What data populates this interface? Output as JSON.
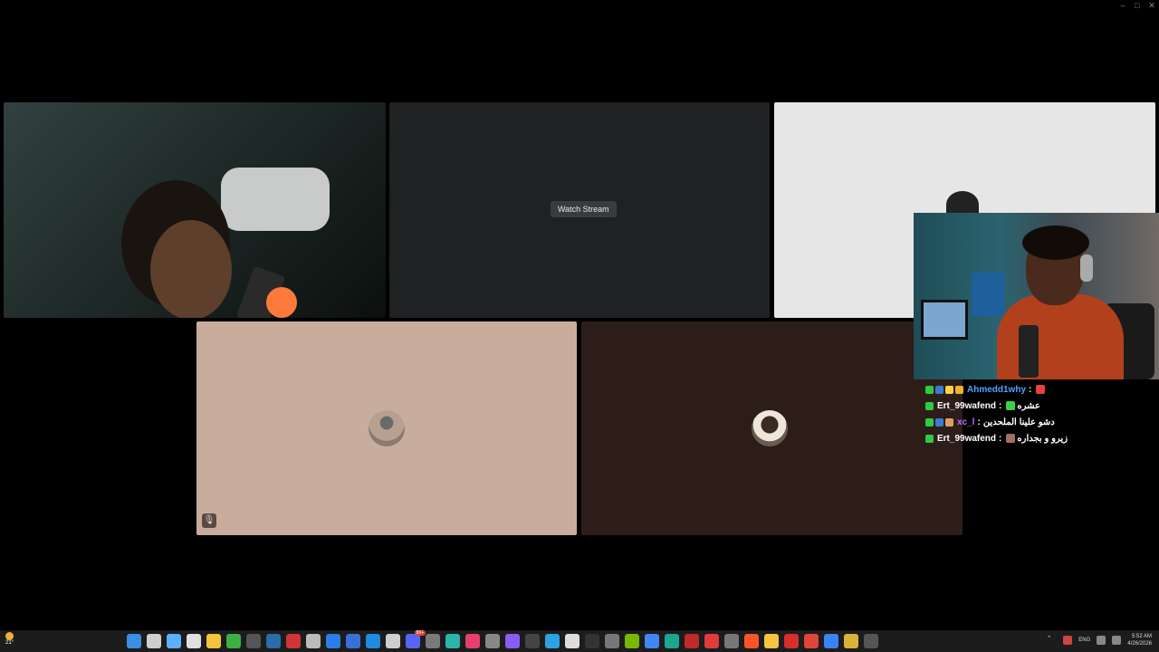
{
  "window": {
    "minimize": "–",
    "maximize": "□",
    "close": "✕"
  },
  "stream_tile": {
    "watch_button": "Watch Stream"
  },
  "tiles": [
    {
      "name": "webcam-tile-1"
    },
    {
      "name": "stream-tile"
    },
    {
      "name": "webcam-tile-3"
    },
    {
      "name": "avatar-tile-4",
      "muted": true
    },
    {
      "name": "avatar-tile-5"
    }
  ],
  "mute_icon": "🎙",
  "chat": [
    {
      "user": "Ahmedd1why",
      "user_color": "#4da3ff",
      "sep": ":",
      "message": "",
      "badges": [
        "#2ecc40",
        "#3a7bd5",
        "#ffd24a",
        "#f0b030"
      ],
      "emote": "#e64040"
    },
    {
      "user": "Ert_99wafend",
      "user_color": "#ffffff",
      "sep": ":",
      "message": "عشره",
      "badges": [
        "#2ecc40"
      ],
      "emote": "#3ccf4e"
    },
    {
      "user": "xc_l",
      "user_color": "#b96fff",
      "sep": ":",
      "message": "دشو علينا الملحدين",
      "badges": [
        "#2ecc40",
        "#3a7bd5",
        "#d9a066"
      ],
      "emote": ""
    },
    {
      "user": "Ert_99wafend",
      "user_color": "#ffffff",
      "sep": ":",
      "message": "زيرو و بجداره",
      "badges": [
        "#2ecc40"
      ],
      "emote": "#a07060"
    }
  ],
  "taskbar": {
    "weather_temp": "21°",
    "icons": [
      {
        "name": "start-icon",
        "color": "#3a8ee6"
      },
      {
        "name": "search-icon",
        "color": "#cfcfcf"
      },
      {
        "name": "copilot-icon",
        "color": "#5ab0ff"
      },
      {
        "name": "task-view-icon",
        "color": "#e0e0e0"
      },
      {
        "name": "file-explorer-icon",
        "color": "#f3c53a"
      },
      {
        "name": "xbox-icon",
        "color": "#3cb043"
      },
      {
        "name": "terminal-icon",
        "color": "#555"
      },
      {
        "name": "steam-icon",
        "color": "#2a6da8"
      },
      {
        "name": "app-red-icon",
        "color": "#d13438"
      },
      {
        "name": "app-gear-icon",
        "color": "#bbb"
      },
      {
        "name": "mail-icon",
        "color": "#2b7de9"
      },
      {
        "name": "app-blue-icon",
        "color": "#3a6fd8"
      },
      {
        "name": "app-blue2-icon",
        "color": "#1f8ae0"
      },
      {
        "name": "notepad-icon",
        "color": "#cfcfcf"
      },
      {
        "name": "discord-icon",
        "color": "#5865f2",
        "badge": "99+"
      },
      {
        "name": "app-atom-icon",
        "color": "#7a7a7a"
      },
      {
        "name": "app-teal-icon",
        "color": "#2bb5a6"
      },
      {
        "name": "tiktok-icon",
        "color": "#e63e6d"
      },
      {
        "name": "github-icon",
        "color": "#888"
      },
      {
        "name": "app-purple-icon",
        "color": "#8a5cf6"
      },
      {
        "name": "app-s-icon",
        "color": "#444"
      },
      {
        "name": "telegram-icon",
        "color": "#2aa3e0"
      },
      {
        "name": "capcut-icon",
        "color": "#ddd"
      },
      {
        "name": "app-dark-icon",
        "color": "#333"
      },
      {
        "name": "app-grid-icon",
        "color": "#777"
      },
      {
        "name": "nvidia-icon",
        "color": "#76b900"
      },
      {
        "name": "chrome-icon",
        "color": "#4285f4"
      },
      {
        "name": "edge-icon",
        "color": "#1da68f"
      },
      {
        "name": "app-rec-icon",
        "color": "#c02a2a"
      },
      {
        "name": "app-red2-icon",
        "color": "#e03a3a"
      },
      {
        "name": "app-music-icon",
        "color": "#777"
      },
      {
        "name": "brave-icon",
        "color": "#fb542b"
      },
      {
        "name": "app-yellow-icon",
        "color": "#f5c542"
      },
      {
        "name": "app-red3-icon",
        "color": "#d62d2d"
      },
      {
        "name": "app-car-icon",
        "color": "#e0453a"
      },
      {
        "name": "app-blue3-icon",
        "color": "#3b82f6"
      },
      {
        "name": "app-medal-icon",
        "color": "#d8b23a"
      },
      {
        "name": "app-grey-icon",
        "color": "#555"
      }
    ],
    "tray": {
      "lang": "ENG",
      "time": "5:52 AM",
      "date": "4/26/2026"
    }
  }
}
